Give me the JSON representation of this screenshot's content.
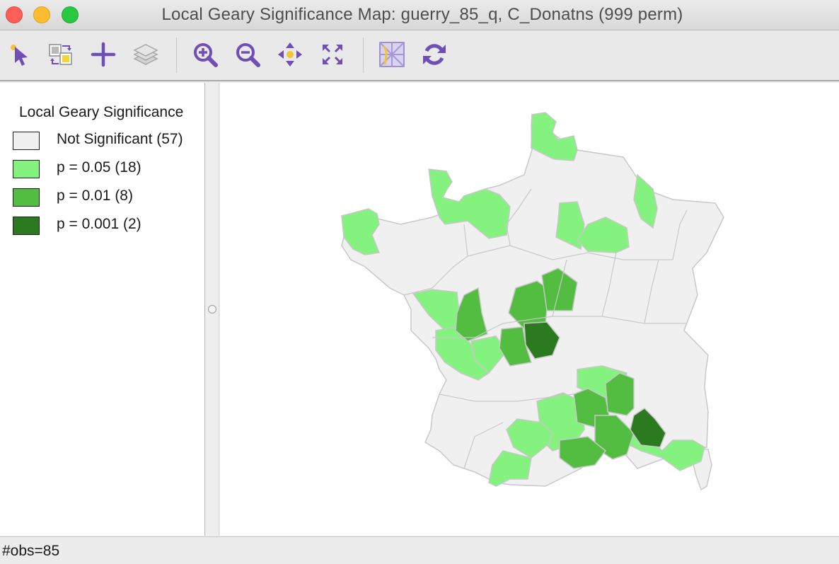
{
  "window": {
    "title": "Local Geary Significance Map: guerry_85_q, C_Donatns (999 perm)"
  },
  "toolbar": {
    "buttons": [
      {
        "name": "select-tool",
        "icon": "select-arrow-icon"
      },
      {
        "name": "select-invert",
        "icon": "invert-selection-icon"
      },
      {
        "name": "add-layer",
        "icon": "plus-icon"
      },
      {
        "name": "layers",
        "icon": "layers-icon"
      },
      {
        "name": "zoom-in",
        "icon": "zoom-in-icon"
      },
      {
        "name": "zoom-out",
        "icon": "zoom-out-icon"
      },
      {
        "name": "pan",
        "icon": "pan-icon"
      },
      {
        "name": "full-extent",
        "icon": "full-extent-icon"
      },
      {
        "name": "basemap",
        "icon": "basemap-icon"
      },
      {
        "name": "refresh",
        "icon": "refresh-icon"
      }
    ]
  },
  "legend": {
    "title": "Local Geary Significance",
    "items": [
      {
        "label": "Not Significant (57)",
        "color": "#f0f0f0"
      },
      {
        "label": "p = 0.05 (18)",
        "color": "#84f27f"
      },
      {
        "label": "p = 0.01 (8)",
        "color": "#52bd40"
      },
      {
        "label": "p = 0.001 (2)",
        "color": "#2c7a1f"
      }
    ]
  },
  "map": {
    "border_color": "#c8c8c8",
    "category_colors": {
      "not_significant": "#f0f0f0",
      "p05": "#84f27f",
      "p01": "#52bd40",
      "p001": "#2c7a1f"
    }
  },
  "status": {
    "text": "#obs=85"
  }
}
